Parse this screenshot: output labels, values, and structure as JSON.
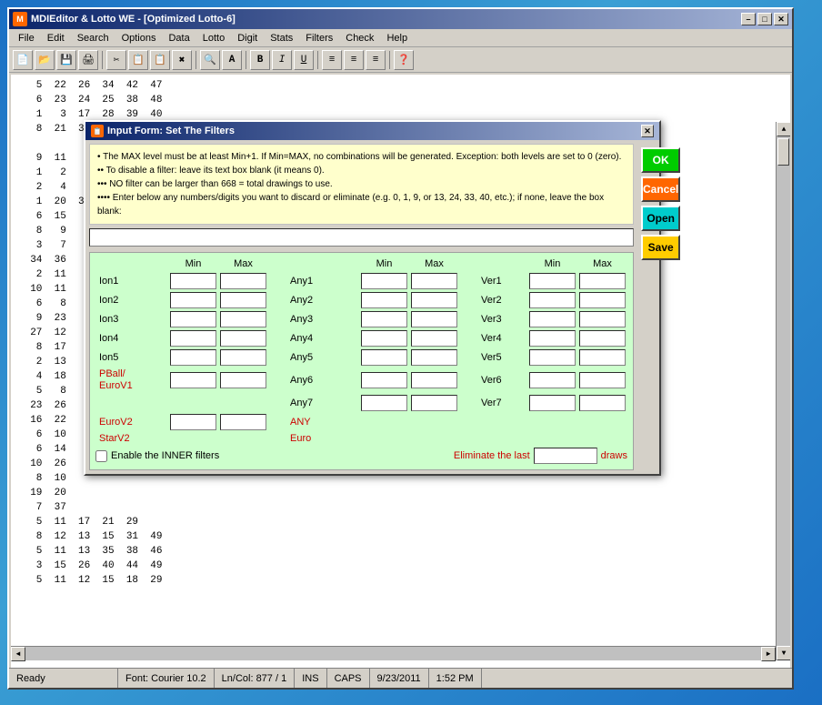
{
  "window": {
    "title": "MDIEditor & Lotto WE - [Optimized Lotto-6]",
    "icon": "🎯"
  },
  "titlebar": {
    "minimize": "–",
    "maximize": "□",
    "close": "✕",
    "sub_minimize": "–",
    "sub_maximize": "□"
  },
  "menu": {
    "items": [
      "File",
      "Edit",
      "Search",
      "Options",
      "Data",
      "Lotto",
      "Digit",
      "Stats",
      "Filters",
      "Check",
      "Help"
    ]
  },
  "toolbar": {
    "icons": [
      "📄",
      "📂",
      "💾",
      "🖨",
      "✂",
      "📋",
      "📋",
      "✖",
      "🔍",
      "A",
      "B",
      "I",
      "U",
      "≡",
      "≡",
      "≡",
      "❓"
    ]
  },
  "background_text": "   5  22  26  34  42  47\n   6  23  24  25  38  48\n   1   3  17  28  39  40\n   8  21  31  35  36  46\n\n   9  11\n   1   2\n   2   4\n   1  20  30  33\n   6  15\n   8   9\n   3   7\n  34  36\n   2  11\n  10  11\n   6   8\n   9  23\n  27  12\n   8  17\n   2  13\n   4  18\n   5   8\n  23  26\n  16  22\n   6  10\n   6  14\n  10  26",
  "dialog": {
    "title": "Input Form: Set The Filters",
    "info_lines": [
      "• The MAX level must be at least Min+1. If Min=MAX, no combinations will be generated.  Exception: both levels are set to 0 (zero).",
      "•• To disable a filter: leave its text box blank (it means 0).",
      "••• NO filter can be larger than 668 = total drawings to use.",
      "•••• Enter below any numbers/digits you want to discard or eliminate  (e.g.  0, 1, 9, or 13, 24, 33, 40, etc.);  if none, leave the box blank:"
    ],
    "text_input_placeholder": "",
    "buttons": {
      "ok": "OK",
      "cancel": "Cancel",
      "open": "Open",
      "save": "Save"
    },
    "grid": {
      "headers": {
        "min": "Min",
        "max": "Max",
        "min2": "Min",
        "max2": "Max",
        "min3": "Min",
        "max3": "Max"
      },
      "rows": [
        {
          "label": "Ion1",
          "red": false,
          "any_label": "Any1",
          "ver_label": "Ver1"
        },
        {
          "label": "Ion2",
          "red": false,
          "any_label": "Any2",
          "ver_label": "Ver2"
        },
        {
          "label": "Ion3",
          "red": false,
          "any_label": "Any3",
          "ver_label": "Ver3"
        },
        {
          "label": "Ion4",
          "red": false,
          "any_label": "Any4",
          "ver_label": "Ver4"
        },
        {
          "label": "Ion5",
          "red": false,
          "any_label": "Any5",
          "ver_label": "Ver5"
        },
        {
          "label": "PBall/\nEuroV1",
          "red": true,
          "any_label": "Any6",
          "ver_label": "Ver6"
        },
        {
          "label": "",
          "red": false,
          "any_label": "Any7",
          "ver_label": "Ver7"
        },
        {
          "label": "EuroV2",
          "red": true,
          "any_label": "ANY",
          "ver_label": ""
        },
        {
          "label": "StarV2",
          "red": true,
          "any_label": "Euro",
          "ver_label": ""
        }
      ]
    },
    "bottom": {
      "checkbox_label": "Enable the INNER filters",
      "eliminate_label": "Eliminate the last",
      "draws_label": "draws"
    }
  },
  "statusbar": {
    "ready": "Ready",
    "font": "Font: Courier 10.2",
    "ln_col": "Ln/Col: 877 / 1",
    "ins": "INS",
    "caps": "CAPS",
    "date": "9/23/2011",
    "time": "1:52 PM"
  }
}
